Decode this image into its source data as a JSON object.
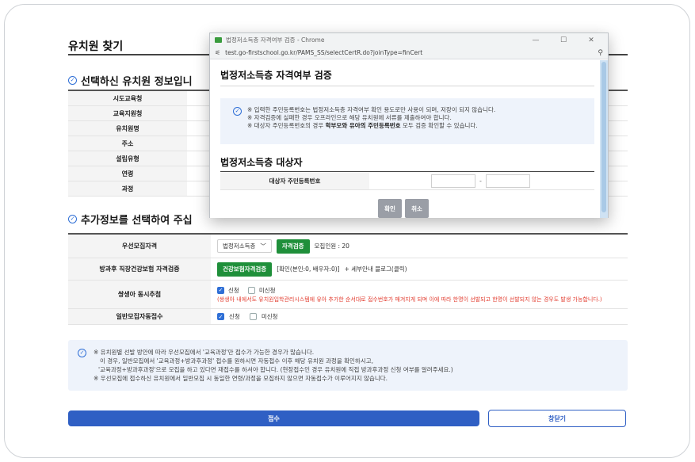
{
  "page": {
    "title": "유치원 찾기",
    "section1_title": "선택하신 유치원 정보입니",
    "info_rows": [
      "시도교육청",
      "교육지원청",
      "유치원명",
      "주소",
      "설립유형",
      "연령",
      "과정"
    ],
    "section2_title": "추가정보를 선택하여 주십",
    "priority": {
      "label": "우선모집자격",
      "select_value": "법정저소득층",
      "verify_button": "자격검증",
      "capacity": "모집인원 : 20"
    },
    "insurance": {
      "label": "방과후 직장건강보험 자격검증",
      "button": "건강보험자격검증",
      "status": "[확인(본인:0, 배우자:0)]",
      "detail_link": "+ 세부안내 블로그(클릭)"
    },
    "twins": {
      "label": "쌍생아 동시추첨",
      "opt_apply": "신청",
      "opt_not_apply": "미신청",
      "warning": "(쌍생아 내에서도 유치원입학관리시스템에 유아 추가한 순서대로 접수번호가 매겨지게 되며 이에 따라 한명이 선발되고 한명이 선발되지 않는 경우도 발생 가능합니다.)"
    },
    "auto_apply": {
      "label": "일반모집자동접수",
      "opt_apply": "신청",
      "opt_not_apply": "미신청"
    },
    "notice_lines": [
      "※ 유치원별 선발 방안에 따라 우선모집에서 '교육과정'만 접수가 가능한 경우가 많습니다.",
      "이 경우, 일반모집에서 '교육과정+방과후과정' 접수를 원하시면 자동접수 이후 해당 유치원 과정을 확인하시고,",
      "'교육과정+방과후과정'으로 모집을 하고 있다면 재접수를 하셔야 합니다. (현장접수인 경우 유치원에 직접 방과후과정 신청 여부를 알려주세요.)",
      "※ 우선모집에 접수하신 유치원에서 일반모집 시 동일한 연령/과정을 모집하지 않으면 자동접수가 이루어지지 않습니다."
    ],
    "submit_button": "접수",
    "close_button": "창닫기"
  },
  "popup": {
    "window_title": "법정저소득층 자격여부 검증 - Chrome",
    "url": "test.go-firstschool.go.kr/PAMS_SS/selectCertR.do?joinType=finCert",
    "heading": "법정저소득층 자격여부 검증",
    "notice_line1": "※ 입력한 주민등록번호는 법정저소득층 자격여부 확인 용도로만 사용이 되며, 저장이 되지 않습니다.",
    "notice_line2": "※ 자격검증에 실패한 경우 오프라인으로 해당 유치원에 서류를 제출하여야 합니다.",
    "notice_line3_pre": "※ 대상자 주민등록번호의 경우 ",
    "notice_line3_bold": "학부모와 유아의 주민등록번호",
    "notice_line3_post": " 모두 검증 확인할 수 있습니다.",
    "subheading": "법정저소득층 대상자",
    "field_label": "대상자 주민등록번호",
    "dash": "-",
    "confirm_button": "확인",
    "cancel_button": "취소"
  },
  "colors": {
    "accent_blue": "#2f5fc4",
    "green_button": "#1f8f3a",
    "warning_red": "#e23b2e",
    "notice_bg": "#eef3fb"
  }
}
